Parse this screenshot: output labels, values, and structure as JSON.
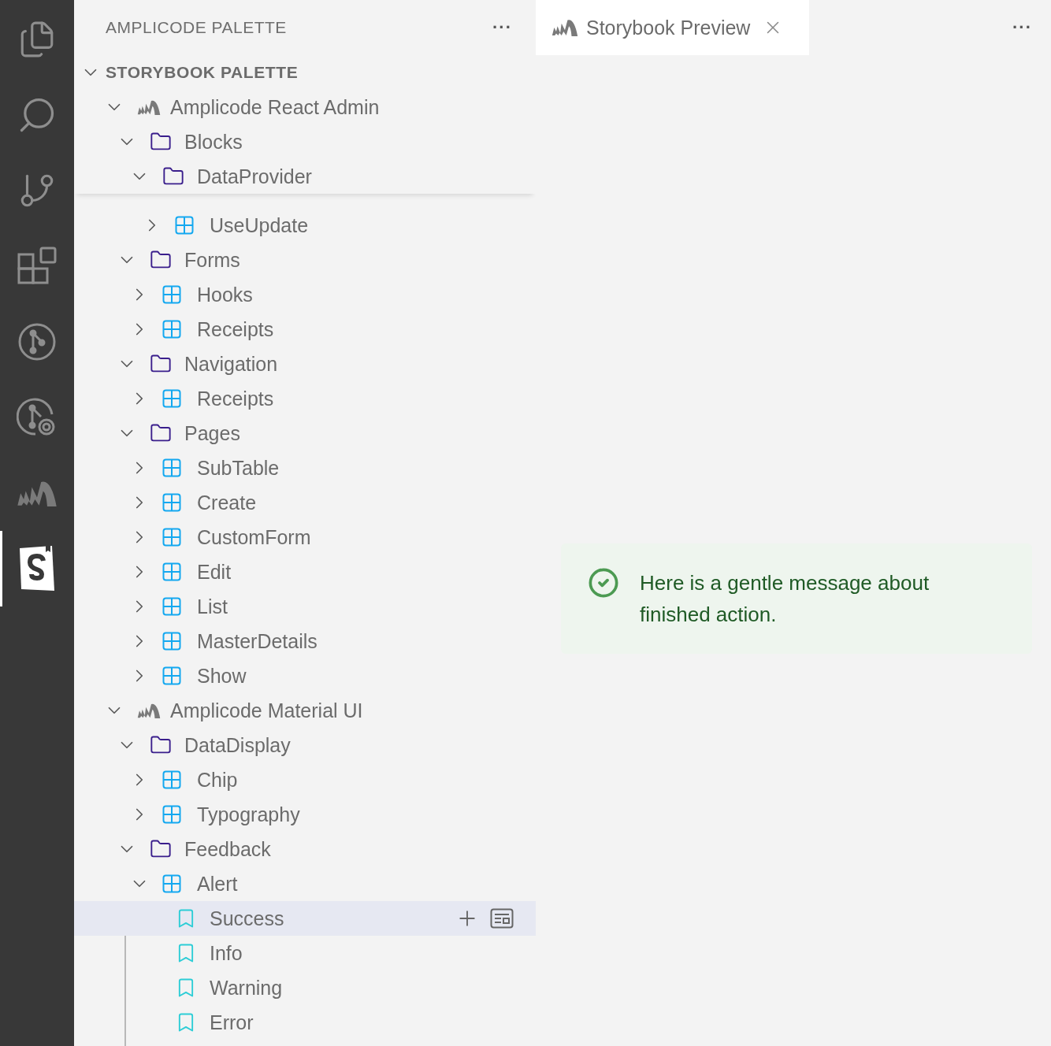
{
  "activity_bar": {
    "items": [
      {
        "kind": "files",
        "selected": false
      },
      {
        "kind": "search",
        "selected": false
      },
      {
        "kind": "source-control",
        "selected": false
      },
      {
        "kind": "extensions",
        "selected": false
      },
      {
        "kind": "git-graph",
        "selected": false
      },
      {
        "kind": "git-search",
        "selected": false
      },
      {
        "kind": "amplicode",
        "selected": false
      },
      {
        "kind": "storybook",
        "selected": true
      }
    ]
  },
  "sidebar": {
    "title": "AMPLICODE PALETTE",
    "more": "···",
    "section": {
      "title": "STORYBOOK PALETTE",
      "expanded": true
    },
    "tree": [
      {
        "kind": "group",
        "label": "Amplicode React Admin",
        "expanded": true,
        "children": [
          {
            "kind": "folder",
            "label": "Blocks",
            "expanded": true,
            "children": [
              {
                "kind": "folder",
                "label": "DataProvider",
                "expanded": true,
                "sticky": true,
                "children": [
                  {
                    "kind": "component",
                    "label": "UseUpdate",
                    "expanded": false
                  }
                ]
              }
            ]
          },
          {
            "kind": "folder",
            "label": "Forms",
            "expanded": true,
            "children": [
              {
                "kind": "component",
                "label": "Hooks",
                "expanded": false
              },
              {
                "kind": "component",
                "label": "Receipts",
                "expanded": false
              }
            ]
          },
          {
            "kind": "folder",
            "label": "Navigation",
            "expanded": true,
            "children": [
              {
                "kind": "component",
                "label": "Receipts",
                "expanded": false
              }
            ]
          },
          {
            "kind": "folder",
            "label": "Pages",
            "expanded": true,
            "children": [
              {
                "kind": "component",
                "label": "SubTable",
                "expanded": false
              },
              {
                "kind": "component",
                "label": "Create",
                "expanded": false
              },
              {
                "kind": "component",
                "label": "CustomForm",
                "expanded": false
              },
              {
                "kind": "component",
                "label": "Edit",
                "expanded": false
              },
              {
                "kind": "component",
                "label": "List",
                "expanded": false
              },
              {
                "kind": "component",
                "label": "MasterDetails",
                "expanded": false
              },
              {
                "kind": "component",
                "label": "Show",
                "expanded": false
              }
            ]
          }
        ]
      },
      {
        "kind": "group",
        "label": "Amplicode Material UI",
        "expanded": true,
        "children": [
          {
            "kind": "folder",
            "label": "DataDisplay",
            "expanded": true,
            "children": [
              {
                "kind": "component",
                "label": "Chip",
                "expanded": false
              },
              {
                "kind": "component",
                "label": "Typography",
                "expanded": false
              }
            ]
          },
          {
            "kind": "folder",
            "label": "Feedback",
            "expanded": true,
            "children": [
              {
                "kind": "component",
                "label": "Alert",
                "expanded": true,
                "children": [
                  {
                    "kind": "story",
                    "label": "Success",
                    "selected": true
                  },
                  {
                    "kind": "story",
                    "label": "Info",
                    "selected": false
                  },
                  {
                    "kind": "story",
                    "label": "Warning",
                    "selected": false
                  },
                  {
                    "kind": "story",
                    "label": "Error",
                    "selected": false
                  }
                ]
              }
            ]
          }
        ]
      }
    ]
  },
  "editor": {
    "tabs": [
      {
        "label": "Storybook Preview",
        "selected": true
      }
    ],
    "more": "···",
    "alert": {
      "kind": "success",
      "message": "Here is a gentle message about finished action."
    }
  }
}
